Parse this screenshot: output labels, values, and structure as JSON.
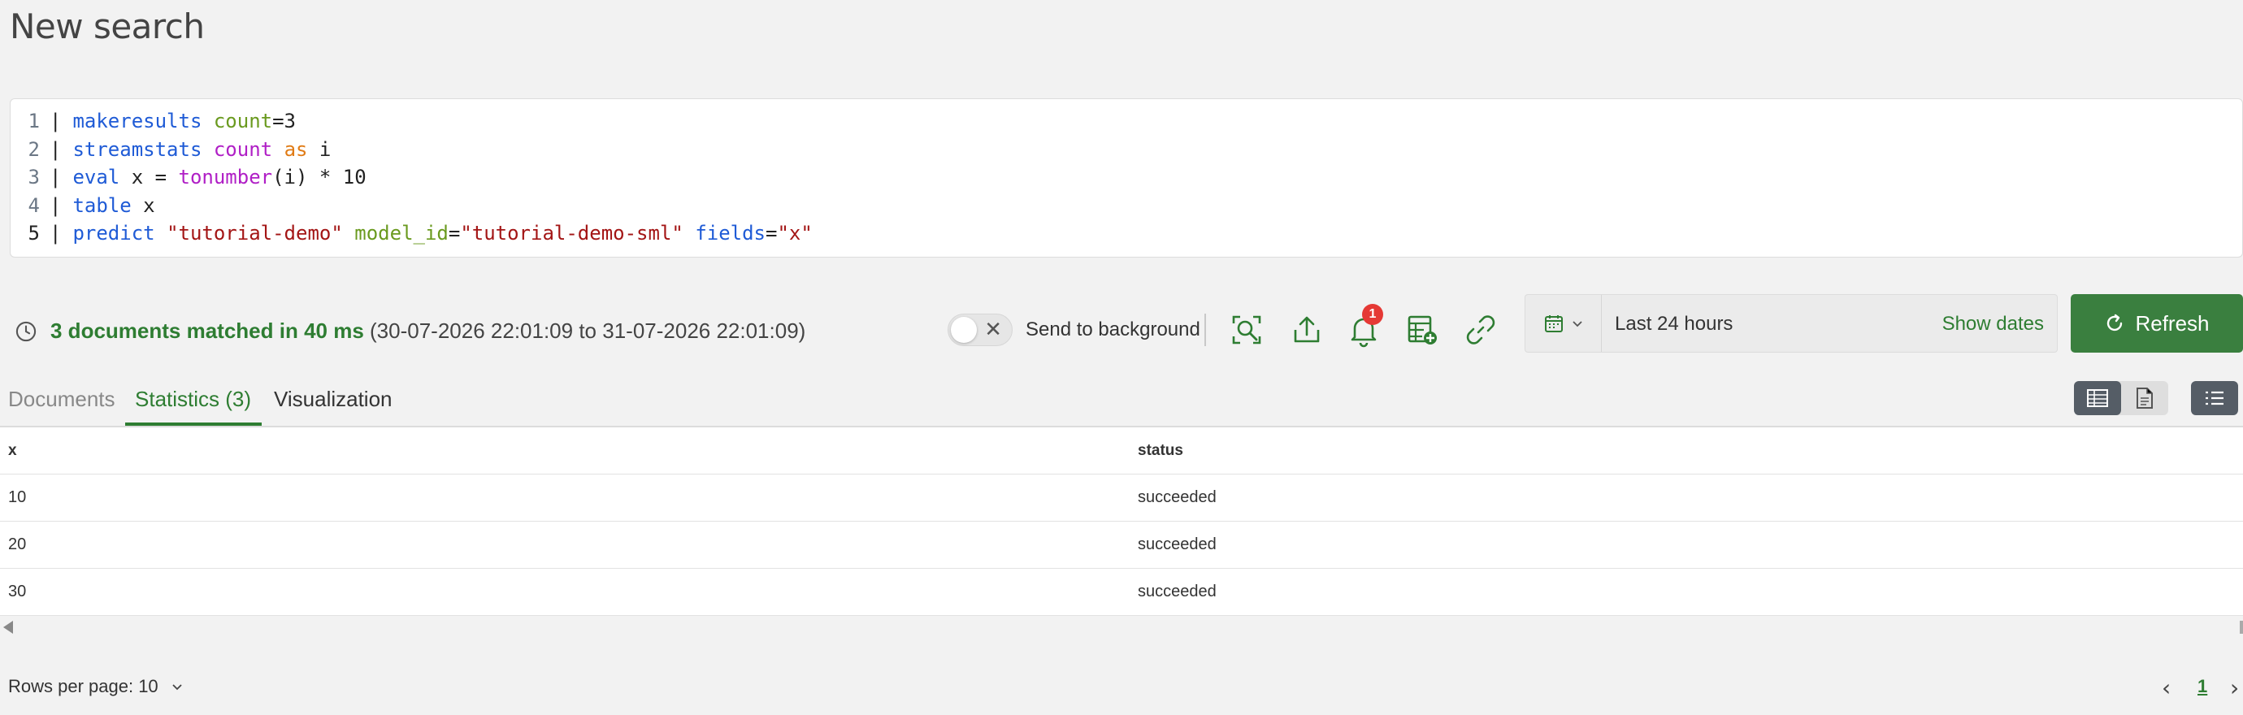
{
  "page": {
    "title": "New search"
  },
  "editor": {
    "lines": [
      {
        "num": "1",
        "tokens": [
          {
            "t": "makeresults",
            "c": "kw-blue"
          },
          {
            "t": " ",
            "c": "plain"
          },
          {
            "t": "count",
            "c": "kw-green"
          },
          {
            "t": "=3",
            "c": "plain"
          }
        ]
      },
      {
        "num": "2",
        "tokens": [
          {
            "t": "streamstats",
            "c": "kw-blue"
          },
          {
            "t": " ",
            "c": "plain"
          },
          {
            "t": "count",
            "c": "kw-purple"
          },
          {
            "t": " ",
            "c": "plain"
          },
          {
            "t": "as",
            "c": "kw-orange"
          },
          {
            "t": " i",
            "c": "plain"
          }
        ]
      },
      {
        "num": "3",
        "tokens": [
          {
            "t": "eval",
            "c": "kw-blue"
          },
          {
            "t": " x = ",
            "c": "plain"
          },
          {
            "t": "tonumber",
            "c": "kw-purple"
          },
          {
            "t": "(i) * 10",
            "c": "plain"
          }
        ]
      },
      {
        "num": "4",
        "tokens": [
          {
            "t": "table",
            "c": "kw-blue"
          },
          {
            "t": " x",
            "c": "plain"
          }
        ]
      },
      {
        "num": "5",
        "tokens": [
          {
            "t": "predict",
            "c": "kw-blue"
          },
          {
            "t": " ",
            "c": "plain"
          },
          {
            "t": "\"tutorial-demo\"",
            "c": "str"
          },
          {
            "t": " ",
            "c": "plain"
          },
          {
            "t": "model_id",
            "c": "kw-green"
          },
          {
            "t": "=",
            "c": "plain"
          },
          {
            "t": "\"tutorial-demo-sml\"",
            "c": "str"
          },
          {
            "t": " ",
            "c": "plain"
          },
          {
            "t": "fields",
            "c": "kw-blue"
          },
          {
            "t": "=",
            "c": "plain"
          },
          {
            "t": "\"x\"",
            "c": "str"
          }
        ]
      }
    ]
  },
  "status": {
    "matched": "3 documents matched in 40 ms",
    "range": " (30-07-2026 22:01:09 to 31-07-2026 22:01:09)",
    "background_label": "Send to background",
    "notification_count": "1"
  },
  "date_picker": {
    "range": "Last 24 hours",
    "show_dates": "Show dates"
  },
  "refresh": {
    "label": "Refresh"
  },
  "tabs": {
    "documents": "Documents",
    "statistics": "Statistics (3)",
    "visualization": "Visualization"
  },
  "table": {
    "columns": [
      "x",
      "status"
    ],
    "rows": [
      {
        "x": "10",
        "status": "succeeded"
      },
      {
        "x": "20",
        "status": "succeeded"
      },
      {
        "x": "30",
        "status": "succeeded"
      }
    ]
  },
  "footer": {
    "rows_per_page": "Rows per page: 10",
    "current_page": "1"
  },
  "colors": {
    "accent": "#2e7d32",
    "refresh_bg": "#3a7f3f",
    "badge": "#e53935"
  }
}
